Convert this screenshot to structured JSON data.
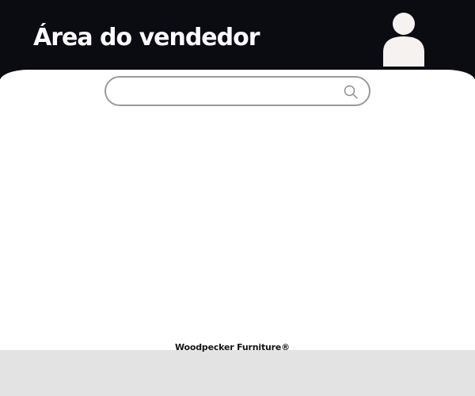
{
  "header": {
    "title": "Área do vendedor",
    "avatar_icon": "user-avatar-icon"
  },
  "search": {
    "value": "",
    "placeholder": "",
    "icon": "search-icon"
  },
  "footer": {
    "brand": "Woodpecker Furniture®"
  },
  "colors": {
    "header_bg": "#0b0b12",
    "footer_bg": "#e3e3e3",
    "search_border": "#9a9a9a",
    "avatar_fill": "#f6f2ef"
  }
}
